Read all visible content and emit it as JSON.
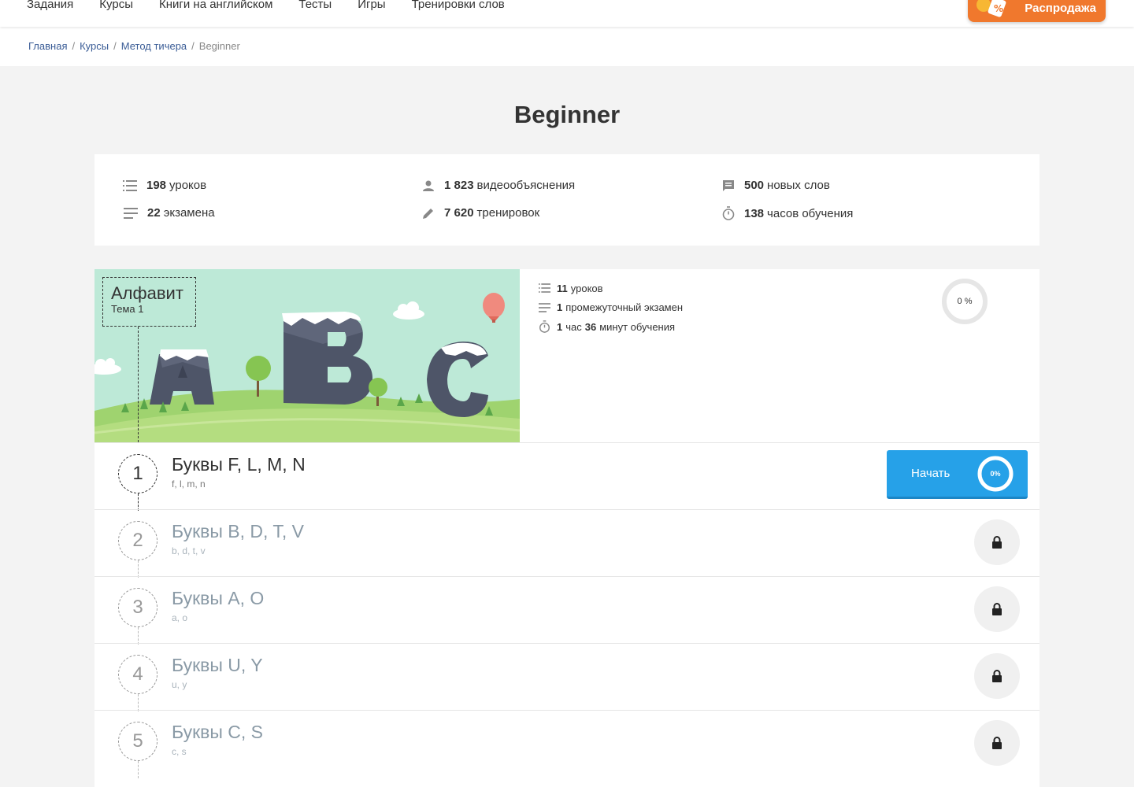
{
  "nav": {
    "items": [
      "Задания",
      "Курсы",
      "Книги на английском",
      "Тесты",
      "Игры",
      "Тренировки слов"
    ],
    "sale_label": "Распродажа"
  },
  "breadcrumb": {
    "items": [
      "Главная",
      "Курсы",
      "Метод тичера"
    ],
    "current": "Beginner"
  },
  "page_title": "Beginner",
  "stats": {
    "lessons": {
      "value": "198",
      "label": "уроков",
      "icon": "list-icon"
    },
    "videos": {
      "value": "1 823",
      "label": "видеообъяснения",
      "icon": "person-icon"
    },
    "words": {
      "value": "500",
      "label": "новых слов",
      "icon": "chat-icon"
    },
    "exams": {
      "value": "22",
      "label": "экзамена",
      "icon": "lines-icon"
    },
    "trainings": {
      "value": "7 620",
      "label": "тренировок",
      "icon": "pencil-icon"
    },
    "hours": {
      "value": "138",
      "label": "часов обучения",
      "icon": "timer-icon"
    }
  },
  "course": {
    "title": "Алфавит",
    "subtitle": "Тема 1",
    "lessons_count": "11",
    "lessons_label": "уроков",
    "exam_count": "1",
    "exam_label": "промежуточный экзамен",
    "time_hours": "1",
    "time_hours_label": "час",
    "time_minutes": "36",
    "time_minutes_label": "минут обучения",
    "progress_label": "0 %",
    "progress": 0
  },
  "lessons": [
    {
      "num": "1",
      "title": "Буквы F, L, M, N",
      "sub": "f, l, m, n",
      "active": true,
      "button": "Начать",
      "progress_label": "0%"
    },
    {
      "num": "2",
      "title": "Буквы B, D, T, V",
      "sub": "b, d, t, v",
      "active": false
    },
    {
      "num": "3",
      "title": "Буквы A, O",
      "sub": "a, o",
      "active": false
    },
    {
      "num": "4",
      "title": "Буквы U, Y",
      "sub": "u, y",
      "active": false
    },
    {
      "num": "5",
      "title": "Буквы C, S",
      "sub": "c, s",
      "active": false
    }
  ],
  "colors": {
    "accent": "#26a1e8",
    "sale": "#f0782d",
    "link": "#3a5c96"
  }
}
